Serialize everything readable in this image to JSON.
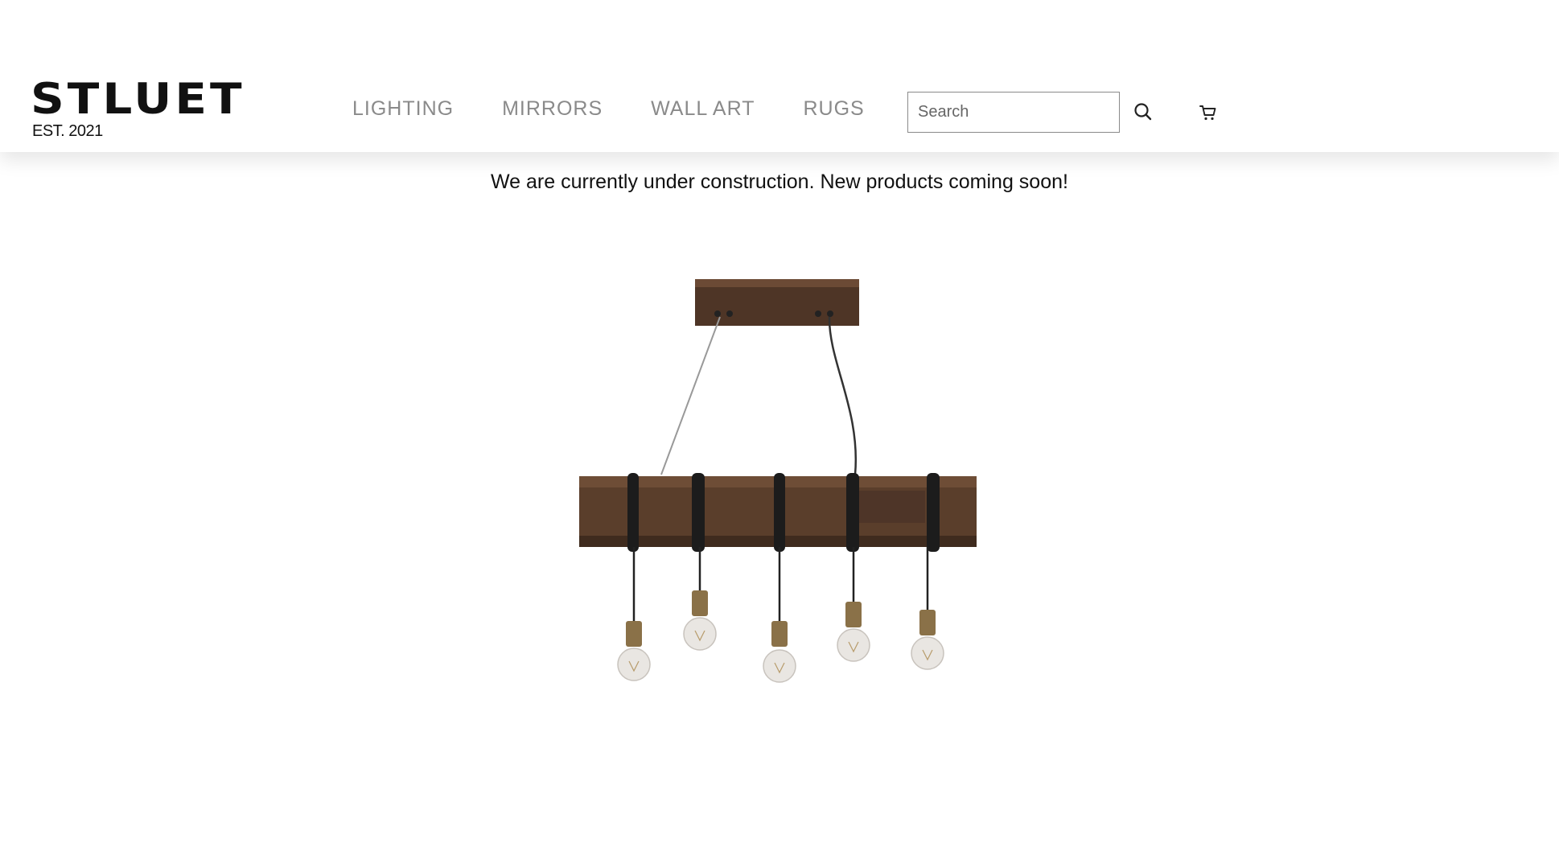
{
  "brand": {
    "logo_text": "STLUET",
    "established": "EST. 2021"
  },
  "nav": {
    "items": [
      {
        "label": "LIGHTING"
      },
      {
        "label": "MIRRORS"
      },
      {
        "label": "WALL ART"
      },
      {
        "label": "RUGS"
      }
    ]
  },
  "search": {
    "placeholder": "Search",
    "value": ""
  },
  "icons": {
    "search": "search-icon",
    "cart": "cart-icon"
  },
  "main": {
    "notice": "We are currently under construction. New products coming soon!"
  },
  "colors": {
    "nav_text": "#8a8a8a",
    "text": "#111111",
    "wood": "#5a3e2b"
  }
}
